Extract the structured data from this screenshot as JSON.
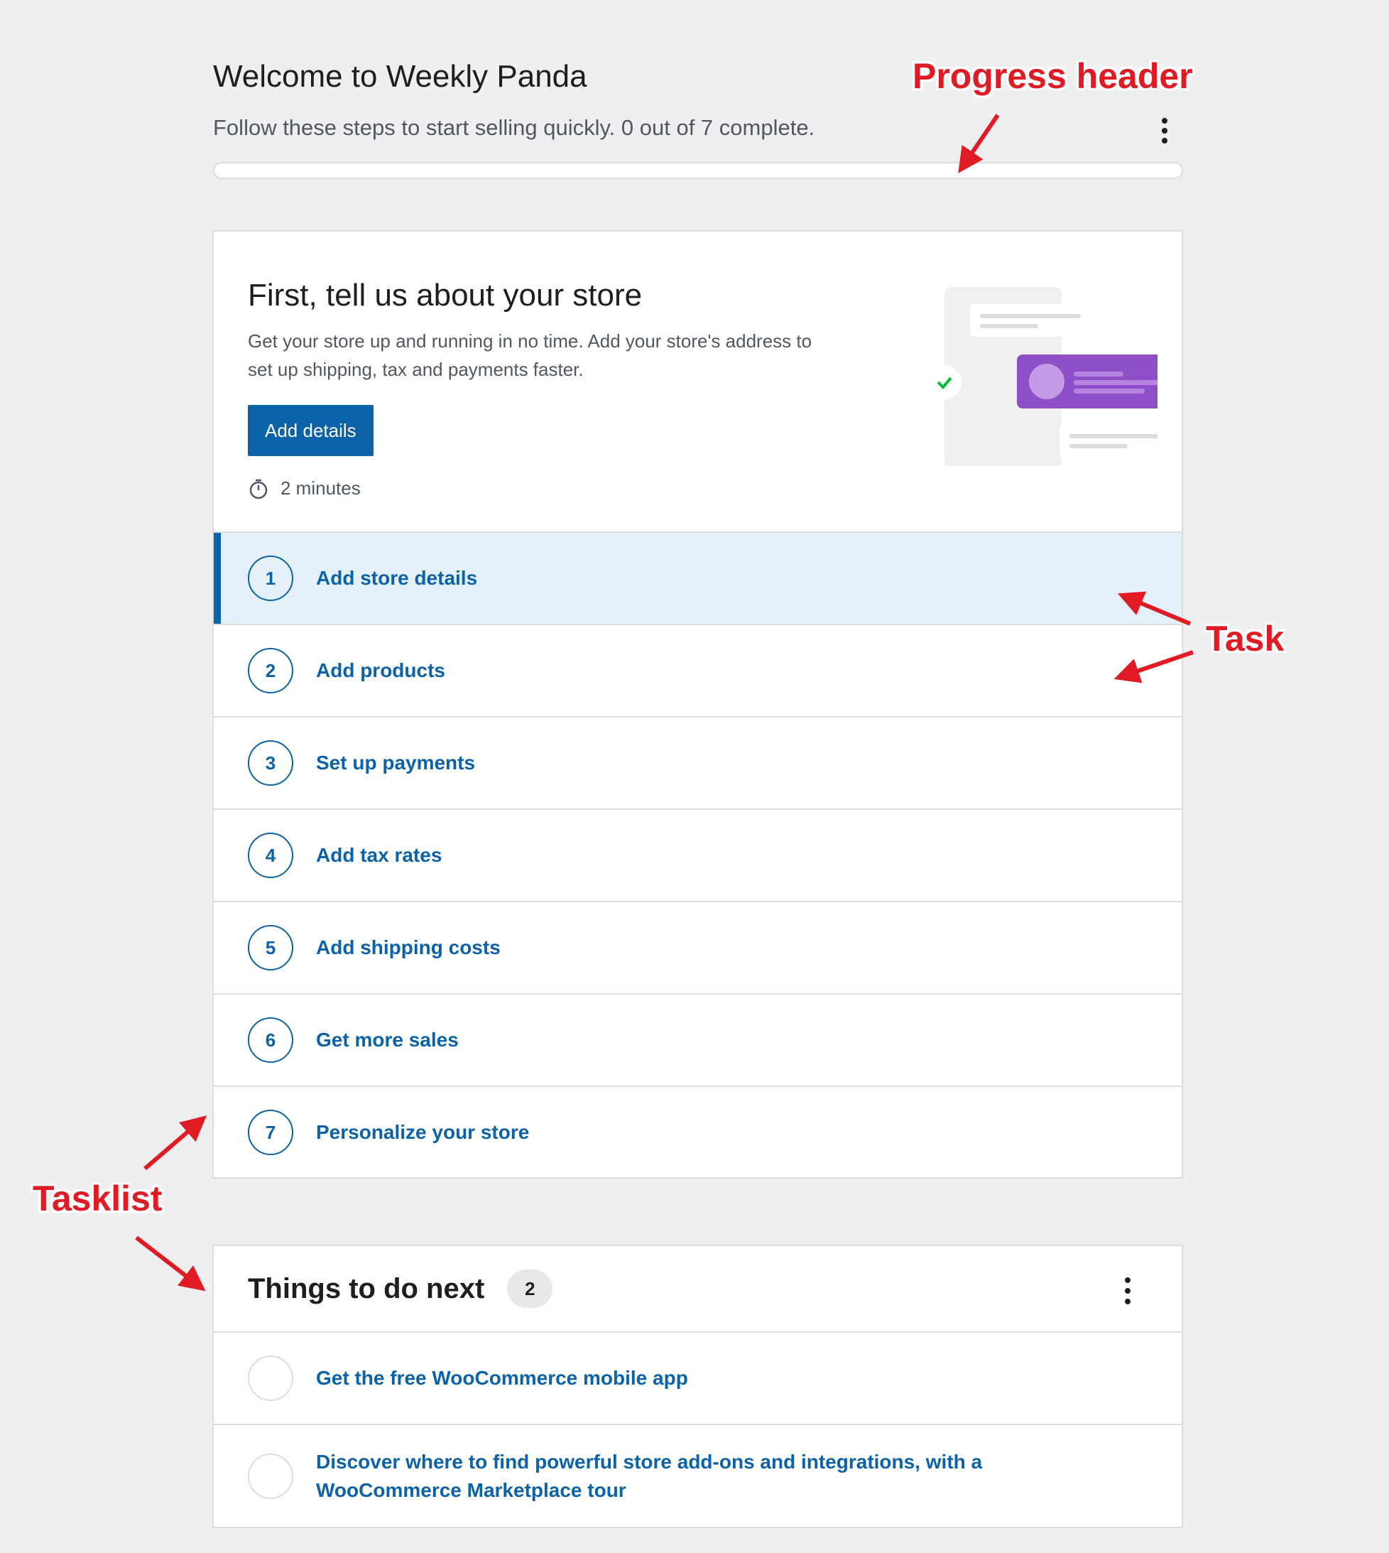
{
  "header": {
    "title": "Welcome to Weekly Panda",
    "subtitle": "Follow these steps to start selling quickly. 0 out of 7 complete.",
    "progress": {
      "completed": 0,
      "total": 7
    }
  },
  "hero": {
    "title": "First, tell us about your store",
    "description": "Get your store up and running in no time. Add your store's address to set up shipping, tax and payments faster.",
    "button_label": "Add details",
    "time_estimate": "2 minutes"
  },
  "tasks": [
    {
      "number": "1",
      "label": "Add store details",
      "active": true
    },
    {
      "number": "2",
      "label": "Add products"
    },
    {
      "number": "3",
      "label": "Set up payments"
    },
    {
      "number": "4",
      "label": "Add tax rates"
    },
    {
      "number": "5",
      "label": "Add shipping costs"
    },
    {
      "number": "6",
      "label": "Get more sales"
    },
    {
      "number": "7",
      "label": "Personalize your store"
    }
  ],
  "next": {
    "title": "Things to do next",
    "count": "2",
    "items": [
      {
        "label": "Get the free WooCommerce mobile app"
      },
      {
        "label": "Discover where to find powerful store add-ons and integrations, with a WooCommerce Marketplace tour"
      }
    ]
  },
  "annotations": {
    "progress_header": "Progress header",
    "task": "Task",
    "tasklist": "Tasklist"
  },
  "colors": {
    "accent": "#0b62a8",
    "annotation": "#e01b24",
    "illustration_purple": "#8e4fc9"
  }
}
